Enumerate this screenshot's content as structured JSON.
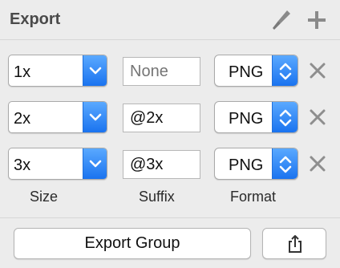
{
  "header": {
    "title": "Export",
    "icons": [
      "knife-icon",
      "plus-icon"
    ]
  },
  "export_rows": [
    {
      "size": "1x",
      "suffix": "",
      "suffix_placeholder": "None",
      "format": "PNG"
    },
    {
      "size": "2x",
      "suffix": "@2x",
      "suffix_placeholder": "None",
      "format": "PNG"
    },
    {
      "size": "3x",
      "suffix": "@3x",
      "suffix_placeholder": "None",
      "format": "PNG"
    }
  ],
  "labels": {
    "size": "Size",
    "suffix": "Suffix",
    "format": "Format"
  },
  "footer": {
    "export_group_label": "Export Group",
    "share_icon": "share-icon"
  },
  "colors": {
    "accent_blue": "#1a73ef",
    "remove_gray": "#8e8e8e",
    "background": "#ececec"
  }
}
